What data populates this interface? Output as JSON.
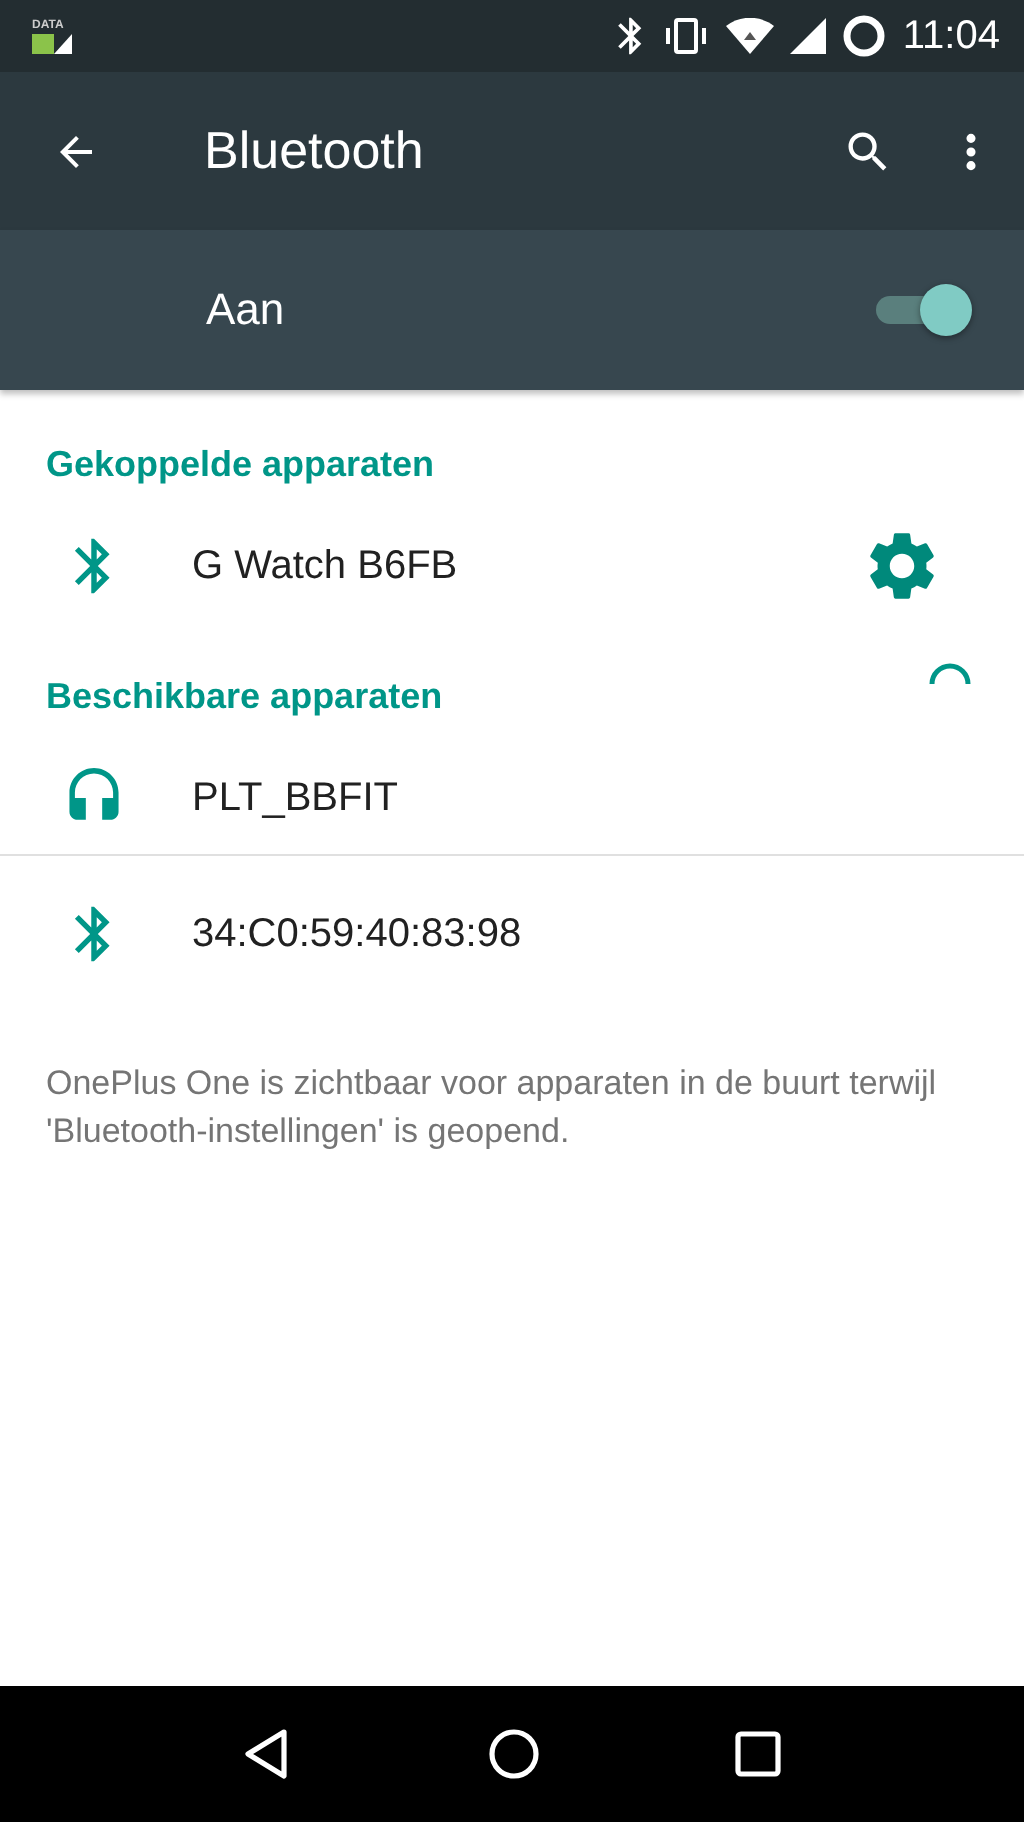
{
  "status_bar": {
    "data_label": "DATA",
    "time": "11:04"
  },
  "toolbar": {
    "title": "Bluetooth"
  },
  "master_switch": {
    "label": "Aan",
    "on": true
  },
  "sections": [
    {
      "title": "Gekoppelde apparaten",
      "scanning": false,
      "devices": [
        {
          "kind": "bluetooth",
          "name": "G Watch B6FB",
          "settings": true
        }
      ]
    },
    {
      "title": "Beschikbare apparaten",
      "scanning": true,
      "devices": [
        {
          "kind": "headphones",
          "name": "PLT_BBFIT",
          "settings": false
        },
        {
          "kind": "bluetooth",
          "name": "34:C0:59:40:83:98",
          "settings": false
        }
      ]
    }
  ],
  "footer": "OnePlus One is zichtbaar voor apparaten in de buurt terwijl 'Bluetooth-instellingen' is geopend."
}
